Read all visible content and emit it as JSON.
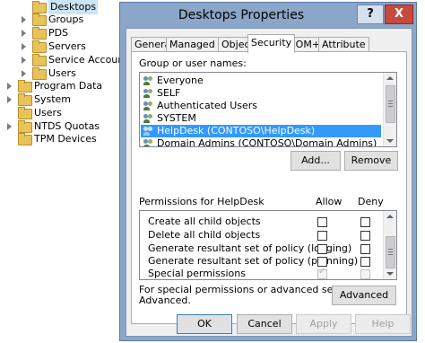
{
  "tree": {
    "items": [
      {
        "label": "Desktops",
        "selected": true,
        "expandable": false
      },
      {
        "label": "Groups",
        "expandable": true
      },
      {
        "label": "PDS",
        "expandable": true
      },
      {
        "label": "Servers",
        "expandable": true
      },
      {
        "label": "Service Accounts",
        "expandable": true
      },
      {
        "label": "Users",
        "expandable": true
      },
      {
        "label": "Program Data",
        "expandable": true
      },
      {
        "label": "System",
        "expandable": true
      },
      {
        "label": "Users",
        "expandable": false
      },
      {
        "label": "NTDS Quotas",
        "expandable": true
      },
      {
        "label": "TPM Devices",
        "expandable": false
      }
    ]
  },
  "dialog": {
    "title": "Desktops Properties",
    "help_button": "?",
    "close_button": "X",
    "tabs": [
      {
        "label": "General",
        "active": false
      },
      {
        "label": "Managed By",
        "active": false
      },
      {
        "label": "Object",
        "active": false
      },
      {
        "label": "Security",
        "active": true
      },
      {
        "label": "COM+",
        "active": false
      },
      {
        "label": "Attribute Editor",
        "active": false
      }
    ],
    "security": {
      "group_label": "Group or user names:",
      "principals": [
        {
          "name": "Everyone",
          "selected": false
        },
        {
          "name": "SELF",
          "selected": false
        },
        {
          "name": "Authenticated Users",
          "selected": false
        },
        {
          "name": "SYSTEM",
          "selected": false
        },
        {
          "name": "HelpDesk (CONTOSO\\HelpDesk)",
          "selected": true
        },
        {
          "name": "Domain Admins (CONTOSO\\Domain Admins)",
          "selected": false
        }
      ],
      "add_button": "Add...",
      "remove_button": "Remove",
      "permissions_for": "Permissions for HelpDesk",
      "allow_header": "Allow",
      "deny_header": "Deny",
      "permissions": [
        {
          "name": "Create all child objects",
          "allow": false,
          "deny": false,
          "disabled": false
        },
        {
          "name": "Delete all child objects",
          "allow": false,
          "deny": false,
          "disabled": false
        },
        {
          "name": "Generate resultant set of policy (logging)",
          "allow": false,
          "deny": false,
          "disabled": false
        },
        {
          "name": "Generate resultant set of policy (planning)",
          "allow": false,
          "deny": false,
          "disabled": false
        },
        {
          "name": "Special permissions",
          "allow": true,
          "deny": false,
          "disabled": true
        }
      ],
      "advanced_text_1": "For special permissions or advanced settings, click",
      "advanced_text_2": "Advanced.",
      "advanced_button": "Advanced"
    },
    "footer": {
      "ok": "OK",
      "cancel": "Cancel",
      "apply": "Apply",
      "help": "Help"
    }
  }
}
